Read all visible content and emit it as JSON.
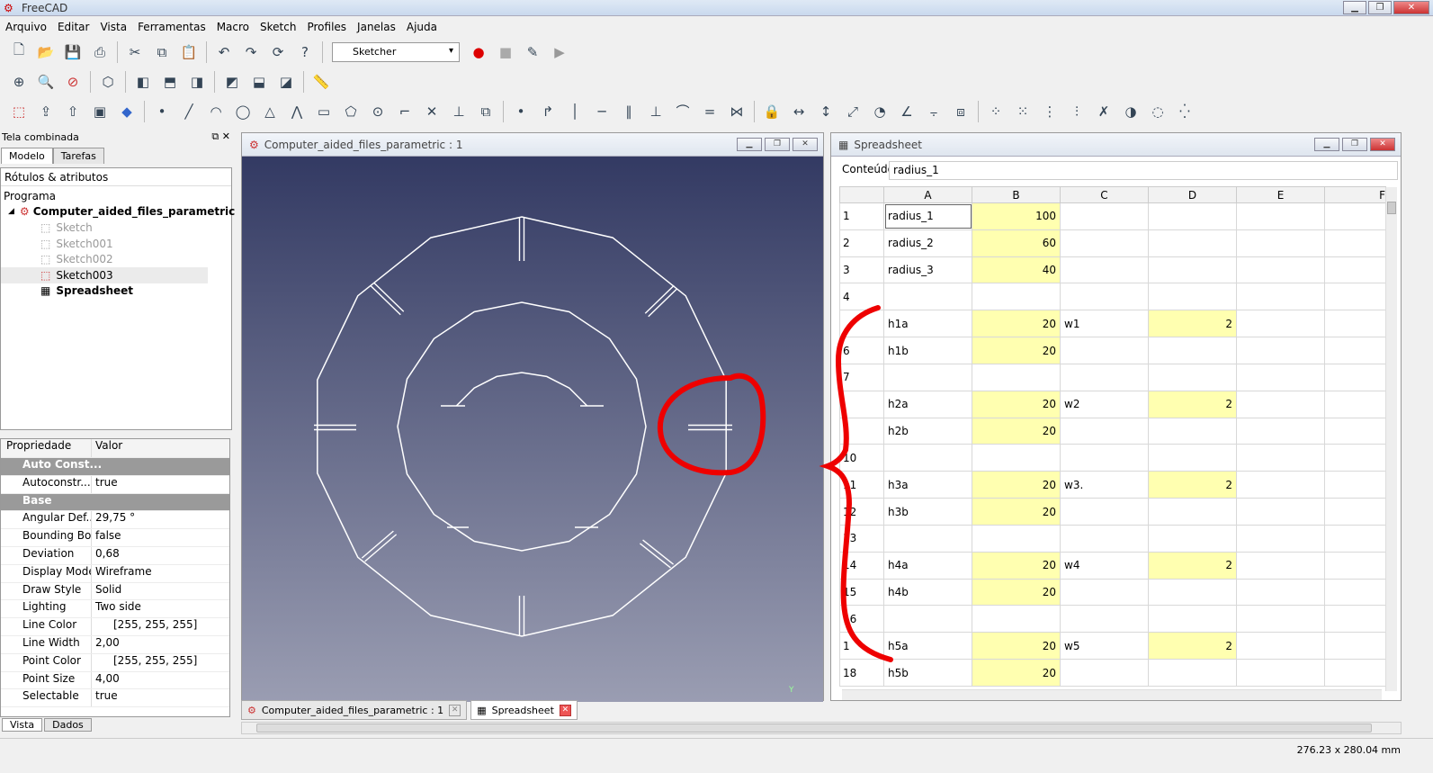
{
  "app": {
    "title": "FreeCAD"
  },
  "menu": [
    "Arquivo",
    "Editar",
    "Vista",
    "Ferramentas",
    "Macro",
    "Sketch",
    "Profiles",
    "Janelas",
    "Ajuda"
  ],
  "toolbar": {
    "workbench": "Sketcher"
  },
  "combo_view": {
    "title": "Tela combinada",
    "tabs": [
      "Modelo",
      "Tarefas"
    ],
    "tree_header": "Rótulos & atributos",
    "tree_section": "Programa",
    "document": "Computer_aided_files_parametric",
    "items": [
      "Sketch",
      "Sketch001",
      "Sketch002",
      "Sketch003",
      "Spreadsheet"
    ],
    "prop_header": {
      "name": "Propriedade",
      "value": "Valor"
    },
    "properties": [
      {
        "name": "Auto Const...",
        "value": "",
        "group": true
      },
      {
        "name": "Autoconstr...",
        "value": "true"
      },
      {
        "name": "Base",
        "value": "",
        "group": true
      },
      {
        "name": "Angular Def...",
        "value": "29,75 °"
      },
      {
        "name": "Bounding Box",
        "value": "false"
      },
      {
        "name": "Deviation",
        "value": "0,68"
      },
      {
        "name": "Display Mode",
        "value": "Wireframe"
      },
      {
        "name": "Draw Style",
        "value": "Solid"
      },
      {
        "name": "Lighting",
        "value": "Two side"
      },
      {
        "name": "Line Color",
        "value": "[255, 255, 255]"
      },
      {
        "name": "Line Width",
        "value": "2,00"
      },
      {
        "name": "Point Color",
        "value": "[255, 255, 255]"
      },
      {
        "name": "Point Size",
        "value": "4,00"
      },
      {
        "name": "Selectable",
        "value": "true"
      }
    ],
    "bottom_tabs": [
      "Vista",
      "Dados"
    ]
  },
  "view3d": {
    "title": "Computer_aided_files_parametric : 1",
    "axis_label": "Y"
  },
  "spreadsheet": {
    "title": "Spreadsheet",
    "content_label": "Conteúdo",
    "content_value": "radius_1",
    "columns": [
      "A",
      "B",
      "C",
      "D",
      "E",
      "F"
    ],
    "rows": [
      {
        "n": "1",
        "a": "radius_1",
        "b": "100",
        "c": "",
        "d": ""
      },
      {
        "n": "2",
        "a": "radius_2",
        "b": "60",
        "c": "",
        "d": ""
      },
      {
        "n": "3",
        "a": "radius_3",
        "b": "40",
        "c": "",
        "d": ""
      },
      {
        "n": "4",
        "a": "",
        "b": "",
        "c": "",
        "d": ""
      },
      {
        "n": "",
        "a": "h1a",
        "b": "20",
        "c": "w1",
        "d": "2"
      },
      {
        "n": "6",
        "a": "h1b",
        "b": "20",
        "c": "",
        "d": ""
      },
      {
        "n": "7",
        "a": "",
        "b": "",
        "c": "",
        "d": ""
      },
      {
        "n": "",
        "a": "h2a",
        "b": "20",
        "c": "w2",
        "d": "2"
      },
      {
        "n": "",
        "a": "h2b",
        "b": "20",
        "c": "",
        "d": ""
      },
      {
        "n": "10",
        "a": "",
        "b": "",
        "c": "",
        "d": ""
      },
      {
        "n": "11",
        "a": "h3a",
        "b": "20",
        "c": "w3.",
        "d": "2"
      },
      {
        "n": "12",
        "a": "h3b",
        "b": "20",
        "c": "",
        "d": ""
      },
      {
        "n": "13",
        "a": "",
        "b": "",
        "c": "",
        "d": ""
      },
      {
        "n": "14",
        "a": "h4a",
        "b": "20",
        "c": "w4",
        "d": "2"
      },
      {
        "n": "15",
        "a": "h4b",
        "b": "20",
        "c": "",
        "d": ""
      },
      {
        "n": "16",
        "a": "",
        "b": "",
        "c": "",
        "d": ""
      },
      {
        "n": "1",
        "a": "h5a",
        "b": "20",
        "c": "w5",
        "d": "2"
      },
      {
        "n": "18",
        "a": "h5b",
        "b": "20",
        "c": "",
        "d": ""
      }
    ]
  },
  "doc_tabs": [
    "Computer_aided_files_parametric : 1",
    "Spreadsheet"
  ],
  "status": {
    "dimensions": "276.23 x 280.04 mm"
  }
}
